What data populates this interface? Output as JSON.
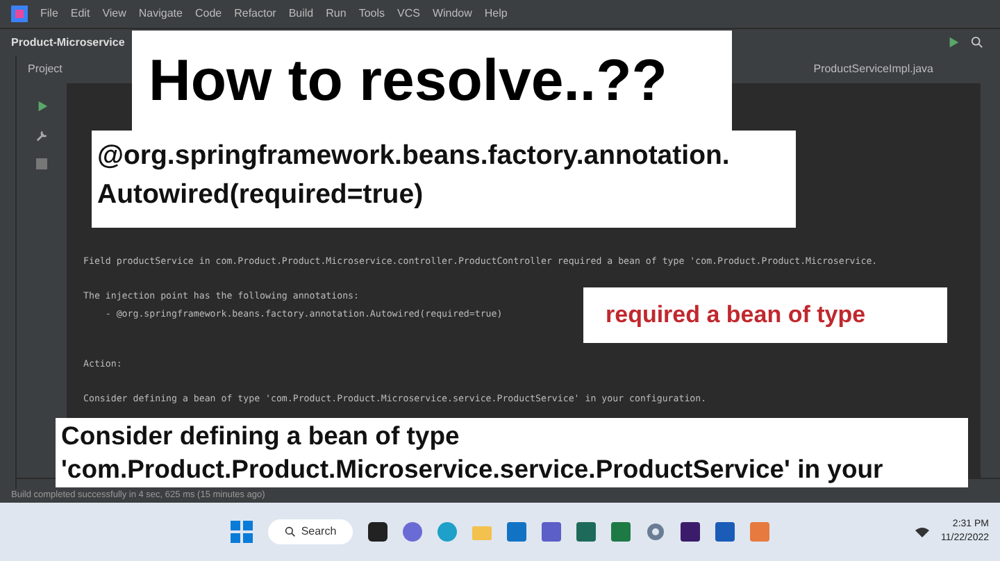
{
  "menu": [
    "File",
    "Edit",
    "View",
    "Navigate",
    "Code",
    "Refactor",
    "Build",
    "Run",
    "Tools",
    "VCS",
    "Window",
    "Help"
  ],
  "project_name": "Product-Microservice",
  "tool_window": {
    "title": "Project"
  },
  "editor_tabs": [
    {
      "label": "ProductServiceImpl.java",
      "selected": false
    }
  ],
  "console": {
    "paragraphs": [
      [
        "Field productService in com.Product.Product.Microservice.controller.ProductController required a bean of type 'com.Product.Product.Microservice."
      ],
      [
        "The injection point has the following annotations:",
        "    - @org.springframework.beans.factory.annotation.Autowired(required=true)"
      ],
      [
        "Action:"
      ],
      [
        "Consider defining a bean of type 'com.Product.Product.Microservice.service.ProductService' in your configuration."
      ]
    ]
  },
  "overlays": [
    {
      "kind": "title",
      "lines": [
        "How to resolve..??"
      ]
    },
    {
      "kind": "note",
      "lines": [
        "@org.springframework.beans.factory.annotation.",
        "Autowired(required=true)"
      ]
    },
    {
      "kind": "highlight",
      "lines": [
        "required a bean of type"
      ]
    },
    {
      "kind": "caption",
      "lines": [
        "Consider defining a bean of type",
        "'com.Product.Product.Microservice.service.ProductService' in your"
      ]
    }
  ],
  "status_bar": {
    "message": "Build completed successfully in 4 sec, 625 ms (15 minutes ago)"
  },
  "taskbar": {
    "search": "Search",
    "time": "2:31 PM",
    "date": "11/22/2022"
  }
}
